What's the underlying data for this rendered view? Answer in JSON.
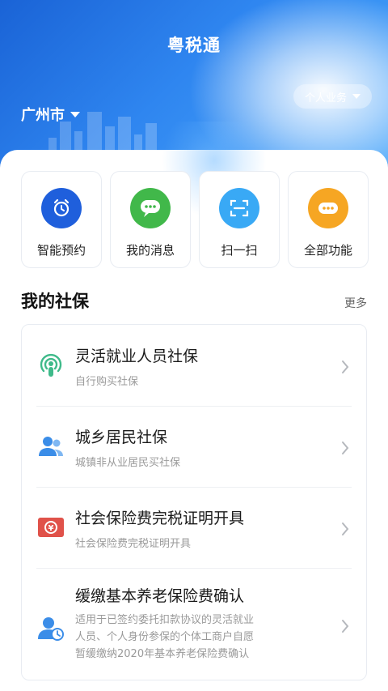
{
  "header": {
    "app_title": "粤税通",
    "city": "广州市",
    "mode": "个人业务"
  },
  "quick_actions": [
    {
      "label": "智能预约",
      "icon": "alarm-clock-icon",
      "color": "#1f5fdc"
    },
    {
      "label": "我的消息",
      "icon": "chat-bubble-icon",
      "color": "#41b84a"
    },
    {
      "label": "扫一扫",
      "icon": "scan-icon",
      "color": "#39a9f5"
    },
    {
      "label": "全部功能",
      "icon": "more-dots-icon",
      "color": "#f6a623"
    }
  ],
  "section": {
    "title": "我的社保",
    "more": "更多"
  },
  "items": [
    {
      "title": "灵活就业人员社保",
      "subtitle": "自行购买社保",
      "icon": "signal-person-icon",
      "color": "#3fba8a"
    },
    {
      "title": "城乡居民社保",
      "subtitle": "城镇非从业居民买社保",
      "icon": "people-icon",
      "color": "#3b8de8"
    },
    {
      "title": "社会保险费完税证明开具",
      "subtitle": "社会保险费完税证明开具",
      "icon": "certificate-icon",
      "color": "#e0524a"
    },
    {
      "title": "缓缴基本养老保险费确认",
      "subtitle_lines": [
        "适用于已签约委托扣款协议的灵活就业",
        "人员、个人身份参保的个体工商户自愿",
        "暂缓缴纳2020年基本养老保险费确认"
      ],
      "icon": "person-clock-icon",
      "color": "#3b8de8"
    }
  ]
}
